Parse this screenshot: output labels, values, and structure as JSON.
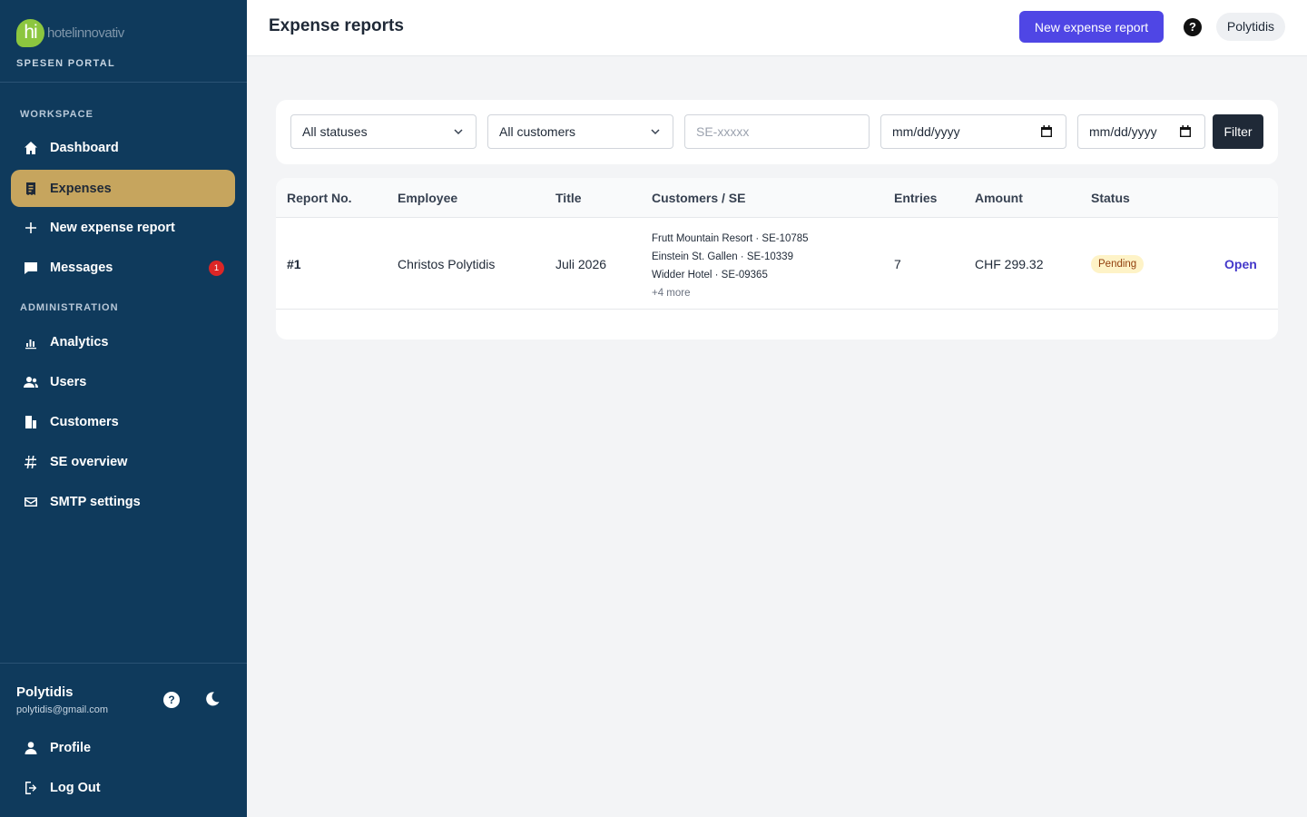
{
  "brand": {
    "logo_mark": "hi",
    "logo_text": "hotelinnovativ",
    "portal": "SPESEN PORTAL"
  },
  "sidebar": {
    "workspace_title": "WORKSPACE",
    "admin_title": "ADMINISTRATION",
    "items": [
      {
        "label": "Dashboard",
        "icon": "home-icon"
      },
      {
        "label": "Expenses",
        "icon": "receipt-icon",
        "active": true
      },
      {
        "label": "New expense report",
        "icon": "plus-icon"
      },
      {
        "label": "Messages",
        "icon": "chat-icon",
        "badge": "1"
      },
      {
        "label": "Analytics",
        "icon": "bar-chart-icon"
      },
      {
        "label": "Users",
        "icon": "users-icon"
      },
      {
        "label": "Customers",
        "icon": "building-icon"
      },
      {
        "label": "SE overview",
        "icon": "hash-icon"
      },
      {
        "label": "SMTP settings",
        "icon": "mail-icon"
      }
    ],
    "user": {
      "name": "Polytidis",
      "email": "polytidis@gmail.com",
      "help": "?"
    },
    "bottom": [
      {
        "label": "Profile",
        "icon": "person-icon"
      },
      {
        "label": "Log Out",
        "icon": "logout-icon"
      }
    ]
  },
  "topbar": {
    "title": "Expense reports",
    "new_button": "New expense report",
    "help": "?",
    "user": "Polytidis"
  },
  "filters": {
    "status": "All statuses",
    "customer": "All customers",
    "se_placeholder": "SE-xxxxx",
    "date_from": "mm/dd/yyyy",
    "date_to": "mm/dd/yyyy",
    "button": "Filter"
  },
  "table": {
    "headers": [
      "Report No.",
      "Employee",
      "Title",
      "Customers / SE",
      "Entries",
      "Amount",
      "Status"
    ],
    "rows": [
      {
        "report_no": "#1",
        "employee": "Christos Polytidis",
        "title": "Juli 2026",
        "customers": [
          "Frutt Mountain Resort · SE-10785",
          "Einstein St. Gallen · SE-10339",
          "Widder Hotel · SE-09365"
        ],
        "more": "+4 more",
        "entries": "7",
        "amount": "CHF 299.32",
        "status": "Pending",
        "action": "Open"
      }
    ]
  },
  "colors": {
    "sidebar": "#0f3a5c",
    "active": "#c6a55e",
    "primary": "#4f46e5",
    "pending_bg": "#fef3c7"
  }
}
